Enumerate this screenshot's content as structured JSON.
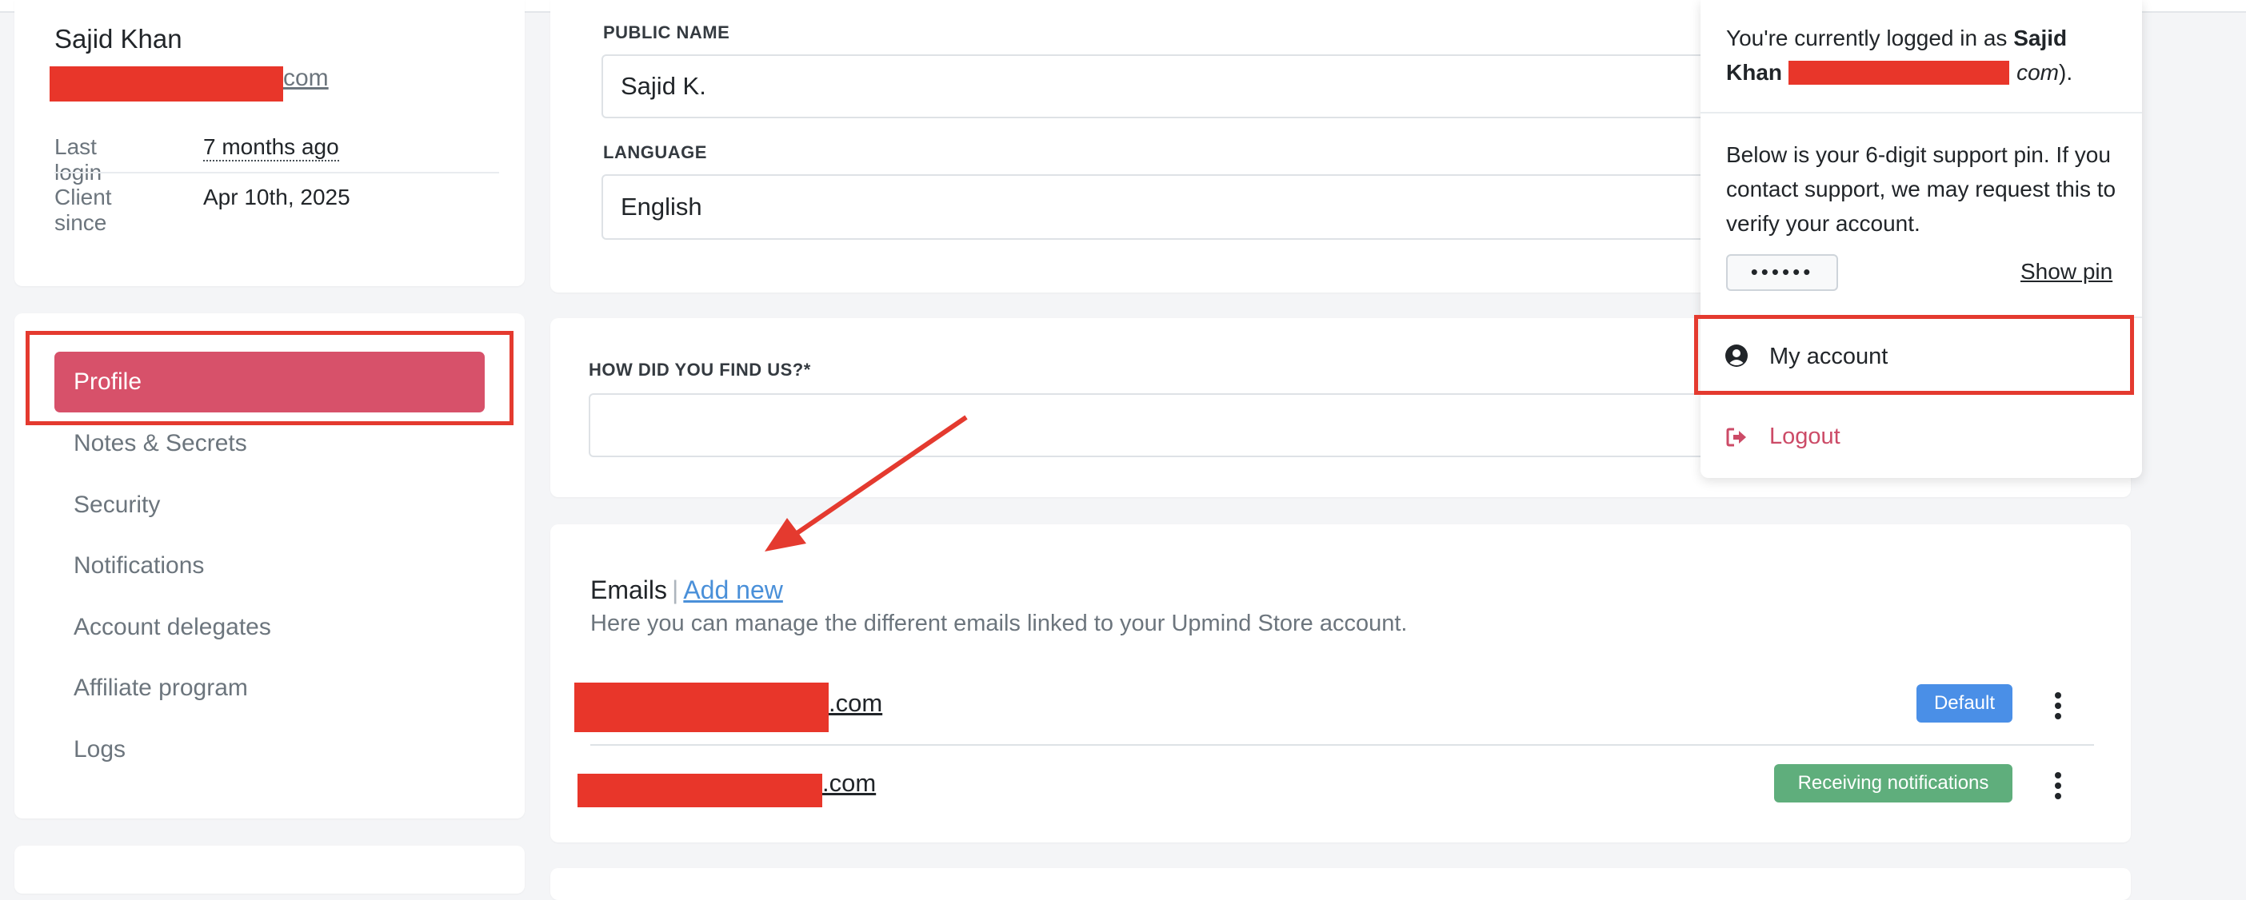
{
  "profile": {
    "name": "Sajid Khan",
    "email_visible_tail": "com",
    "last_login_label": "Last login",
    "last_login_value": "7 months ago",
    "client_since_label": "Client since",
    "client_since_value": "Apr 10th, 2025"
  },
  "sidebar": {
    "items": [
      {
        "label": "Profile",
        "active": true
      },
      {
        "label": "Notes & Secrets"
      },
      {
        "label": "Security"
      },
      {
        "label": "Notifications"
      },
      {
        "label": "Account delegates"
      },
      {
        "label": "Affiliate program"
      },
      {
        "label": "Logs"
      }
    ]
  },
  "form": {
    "public_name_label": "PUBLIC NAME",
    "public_name_value": "Sajid K.",
    "language_label": "LANGUAGE",
    "language_value": "English",
    "find_us_label": "HOW DID YOU FIND US?*",
    "find_us_value": ""
  },
  "emails": {
    "title": "Emails",
    "separator": "|",
    "add_new": "Add new",
    "description": "Here you can manage the different emails linked to your Upmind Store account.",
    "rows": [
      {
        "visible_tail": ".com",
        "badge": "Default",
        "badge_color": "#4a8fe7"
      },
      {
        "visible_tail": ".com",
        "badge": "Receiving notifications",
        "badge_color": "#5fae7c"
      }
    ]
  },
  "dropdown": {
    "logged_in_prefix": "You're currently logged in as",
    "logged_in_name_line1": "Sajid",
    "logged_in_name_line2": "Khan",
    "logged_in_email_tail": "com",
    "logged_in_suffix": ").",
    "pin_text": "Below is your 6-digit support pin. If you contact support, we may request this to verify your account.",
    "pin_masked": "••••••",
    "show_pin": "Show pin",
    "my_account": "My account",
    "logout": "Logout",
    "logout_color": "#cc4b67"
  },
  "colors": {
    "accent": "#d7516a",
    "annotation_red": "#e43a2f"
  },
  "icons": {
    "my_account": "user-circle-icon",
    "logout": "sign-out-icon",
    "email_menu": "kebab-icon"
  }
}
